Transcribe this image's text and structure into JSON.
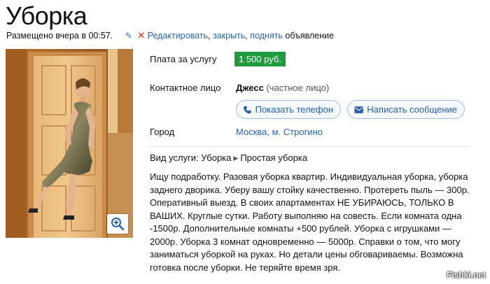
{
  "ad": {
    "title": "Уборка",
    "posted": "Размещено вчера в 00:57.",
    "action_edit": "Редактировать",
    "sep1": ", ",
    "action_close": "закрыть",
    "sep2": ", ",
    "action_raise": "поднять",
    "action_suffix": " объявление"
  },
  "details": {
    "price_label": "Плата за услугу",
    "price_value": "1 500 руб.",
    "contact_label": "Контактное лицо",
    "contact_name": "Джесс",
    "contact_type": " (частное лицо)",
    "show_phone": "Показать телефон",
    "write_message": "Написать сообщение",
    "city_label": "Город",
    "city_value": "Москва, м. Строгино"
  },
  "service": {
    "prefix": "Вид услуги: ",
    "category": "Уборка",
    "subcategory": "Простая уборка"
  },
  "description": "Ищу подработку. Разовая уборка квартир. Индивидуальная уборка, уборка заднего дворика. Уберу вашу стойку качественно. Протереть пыль — 300р. Оперативный выезд. В своих апартаментах НЕ УБИРАЮСЬ, ТОЛЬКО В ВАШИХ. Круглые сутки. Работу выполняю на совесть. Если комната одна -1500р. Дополнительные комнаты +500 рублей. Уборка с игрушками — 2000р. Уборка 3 комнат одновременно — 5000р. Справки о том, что могу заниматься уборкой на руках. Но детали цены обговариваемы. Возможна готовка после уборки. Не теряйте время зря.",
  "watermark": "Fishki.net",
  "colors": {
    "link": "#2563b4",
    "price_badge": "#1e9b3c",
    "button_border": "#9dbde6"
  }
}
